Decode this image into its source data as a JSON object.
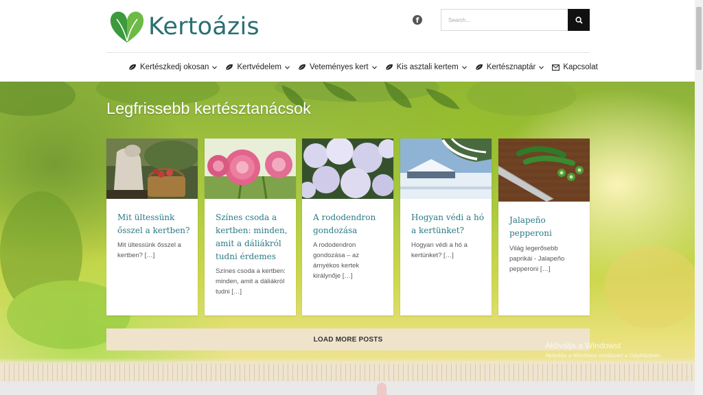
{
  "brand": {
    "name": "Kertoázis",
    "text_color": "#2a6f74",
    "logo_colors": [
      "#3c9a3c",
      "#6dbb46"
    ]
  },
  "header": {
    "social_icon": "facebook-icon",
    "search": {
      "placeholder": "Search...",
      "button_icon": "search-icon"
    }
  },
  "nav": {
    "items": [
      {
        "label": "Kertészkedj okosan",
        "icon": "leaf-icon",
        "dropdown": true
      },
      {
        "label": "Kertvédelem",
        "icon": "leaf-icon",
        "dropdown": true
      },
      {
        "label": "Veteményes kert",
        "icon": "leaf-icon",
        "dropdown": true
      },
      {
        "label": "Kis asztali kertem",
        "icon": "leaf-icon",
        "dropdown": true
      },
      {
        "label": "Kertésznaptár",
        "icon": "leaf-icon",
        "dropdown": true
      },
      {
        "label": "Kapcsolat",
        "icon": "envelope-icon",
        "dropdown": false
      }
    ]
  },
  "hero": {
    "title": "Legfrissebb kertésztanácsok"
  },
  "posts": [
    {
      "title": "Mit ültessünk ősszel a kertben?",
      "excerpt": "Mit ültessünk ősszel a kertben? […]",
      "image": "gardener-basket-image"
    },
    {
      "title": "Színes csoda a kertben: minden, amit a dáliákról tudni érdemes",
      "excerpt": "Színes csoda a kertben: minden, amit a dáliákról tudni […]",
      "image": "dahlia-image"
    },
    {
      "title": "A rododendron gondozása",
      "excerpt": "A rododendron gondozása – az árnyékos kertek királynője […]",
      "image": "rhododendron-image"
    },
    {
      "title": "Hogyan védi a hó a kertünket?",
      "excerpt": "Hogyan védi a hó a kertünket? […]",
      "image": "snow-image"
    },
    {
      "title": "Jalapeño pepperoni",
      "excerpt": "Világ legerősebb paprikái - Jalapeño pepperoni […]",
      "image": "jalapeno-image"
    }
  ],
  "load_more": {
    "label": "LOAD MORE POSTS"
  },
  "windows_watermark": {
    "line1": "Aktiválja a Windowst",
    "line2": "Aktiválja a Windows rendszert a Gépházban."
  },
  "colors": {
    "accent": "#2a7a86",
    "load_more_bg": "#efe4cb",
    "search_button_bg": "#111111"
  }
}
